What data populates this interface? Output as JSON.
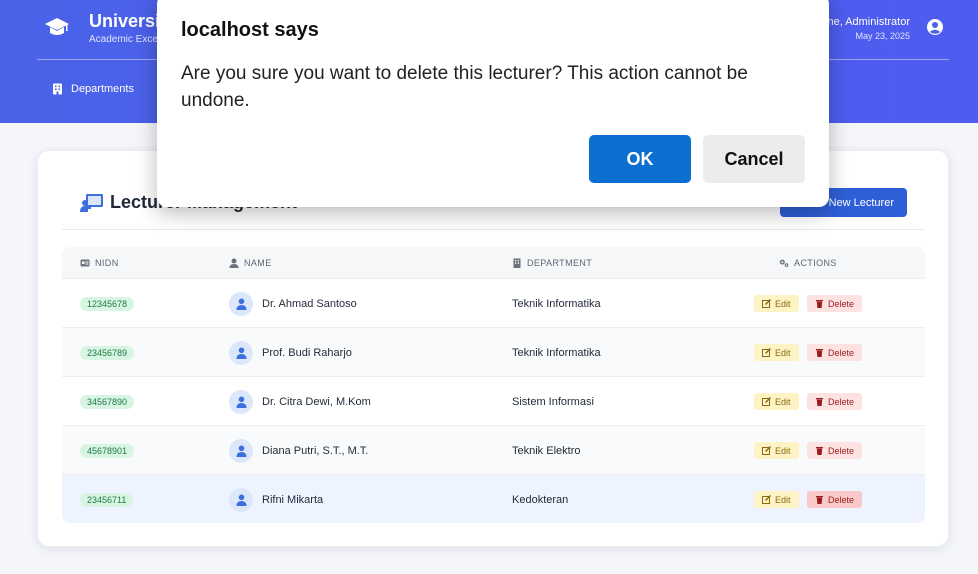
{
  "header": {
    "title": "Universi",
    "subtitle": "Academic Exce",
    "user_greeting": "ne, Administrator",
    "date": "May 23, 2025",
    "nav": [
      {
        "label": "Departments",
        "icon": "building-icon"
      }
    ]
  },
  "card": {
    "title": "Lecturer Management",
    "add_button_label": "New Lecturer",
    "columns": {
      "nidn": "NIDN",
      "name": "NAME",
      "department": "DEPARTMENT",
      "actions": "ACTIONS"
    },
    "rows": [
      {
        "nidn": "12345678",
        "name": "Dr. Ahmad Santoso",
        "department": "Teknik Informatika"
      },
      {
        "nidn": "23456789",
        "name": "Prof. Budi Raharjo",
        "department": "Teknik Informatika"
      },
      {
        "nidn": "34567890",
        "name": "Dr. Citra Dewi, M.Kom",
        "department": "Sistem Informasi"
      },
      {
        "nidn": "45678901",
        "name": "Diana Putri, S.T., M.T.",
        "department": "Teknik Elektro"
      },
      {
        "nidn": "23456711",
        "name": "Rifni Mikarta",
        "department": "Kedokteran"
      }
    ],
    "edit_label": "Edit",
    "delete_label": "Delete"
  },
  "dialog": {
    "title": "localhost says",
    "message": "Are you sure you want to delete this lecturer? This action cannot be undone.",
    "ok_label": "OK",
    "cancel_label": "Cancel"
  },
  "colors": {
    "header_bg": "#4a62e8",
    "primary": "#2f5fd8",
    "ok_button": "#0b6fd0",
    "nidn_badge": "#d8f5e3",
    "edit_bg": "#fdf3c4",
    "delete_bg": "#fde2e2"
  }
}
